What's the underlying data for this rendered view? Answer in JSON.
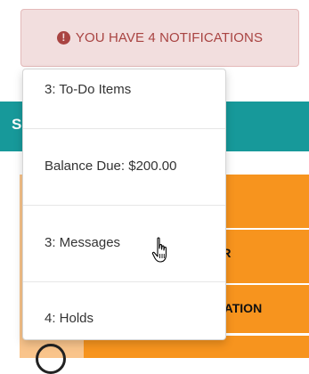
{
  "notification_button": {
    "label": "YOU HAVE 4 NOTIFICATIONS",
    "icon": "exclamation-circle-icon",
    "icon_glyph": "!",
    "bg_color": "#f2dede",
    "text_color": "#a94442"
  },
  "dropdown": {
    "items": [
      {
        "label": "3: To-Do Items"
      },
      {
        "label": "Balance Due: $200.00"
      },
      {
        "label": "3: Messages"
      },
      {
        "label": "4: Holds"
      }
    ]
  },
  "background": {
    "teal_header_letter": "S",
    "rows": [
      {
        "text": "ER"
      },
      {
        "text": "MATION"
      }
    ],
    "accent_teal": "#17999a",
    "accent_orange": "#f7941e"
  }
}
